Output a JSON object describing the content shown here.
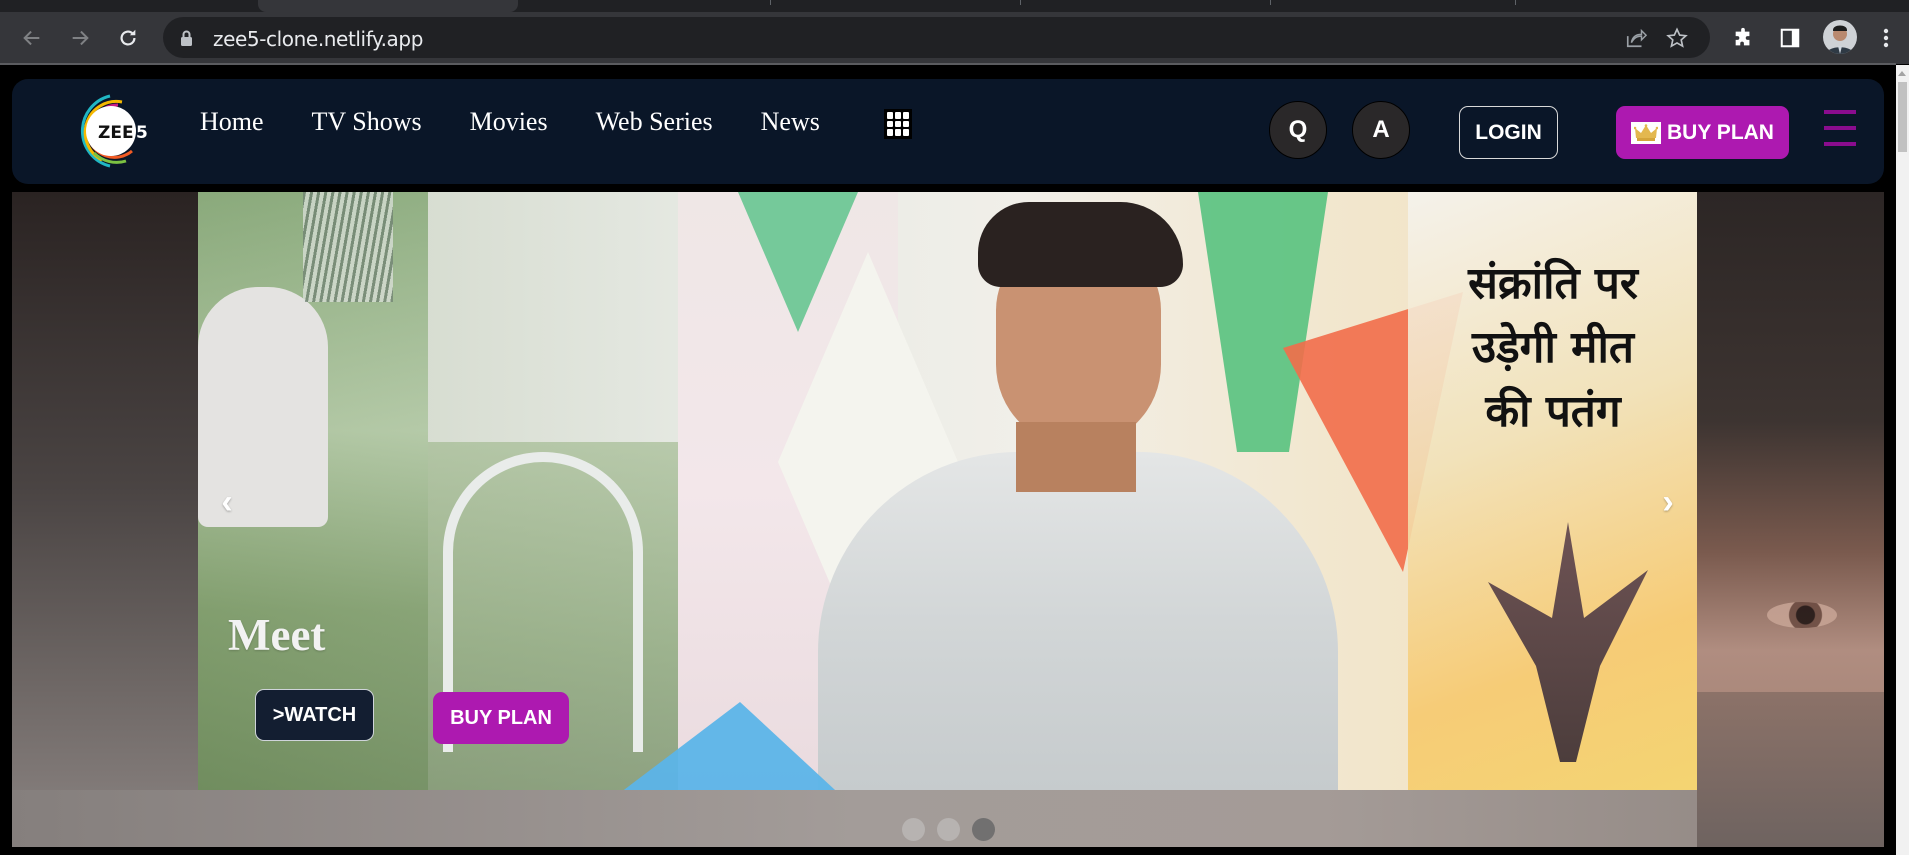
{
  "browser": {
    "url": "zee5-clone.netlify.app",
    "icons": {
      "back": "arrow-left-icon",
      "forward": "arrow-right-icon",
      "reload": "reload-icon",
      "lock": "lock-icon",
      "share": "share-icon",
      "bookmark": "star-icon",
      "extensions": "puzzle-icon",
      "side_panel": "side-panel-icon",
      "profile": "profile-avatar",
      "menu": "kebab-menu-icon"
    }
  },
  "header": {
    "logo_text": "ZEE5",
    "logo_main": "ZEE",
    "logo_digit": "5",
    "nav": [
      {
        "label": "Home"
      },
      {
        "label": "TV Shows"
      },
      {
        "label": "Movies"
      },
      {
        "label": "Web Series"
      },
      {
        "label": "News"
      }
    ],
    "more_icon": "grid-icon",
    "search_label": "Q",
    "language_label": "A",
    "login_label": "LOGIN",
    "buy_plan_label": "BUY PLAN",
    "menu_icon": "hamburger-icon",
    "colors": {
      "header_bg": "#0a1628",
      "accent": "#ad19b0",
      "hamburger": "#8a0c8e"
    }
  },
  "hero": {
    "slide_title": "Meet",
    "overlay_text": [
      "संक्रांति पर",
      "उड़ेगी मीत",
      "की पतंग"
    ],
    "watch_label": ">WATCH",
    "buy_plan_label": "BUY PLAN",
    "prev_label": "‹",
    "next_label": "›",
    "slides_total": 3,
    "active_slide": 3
  }
}
